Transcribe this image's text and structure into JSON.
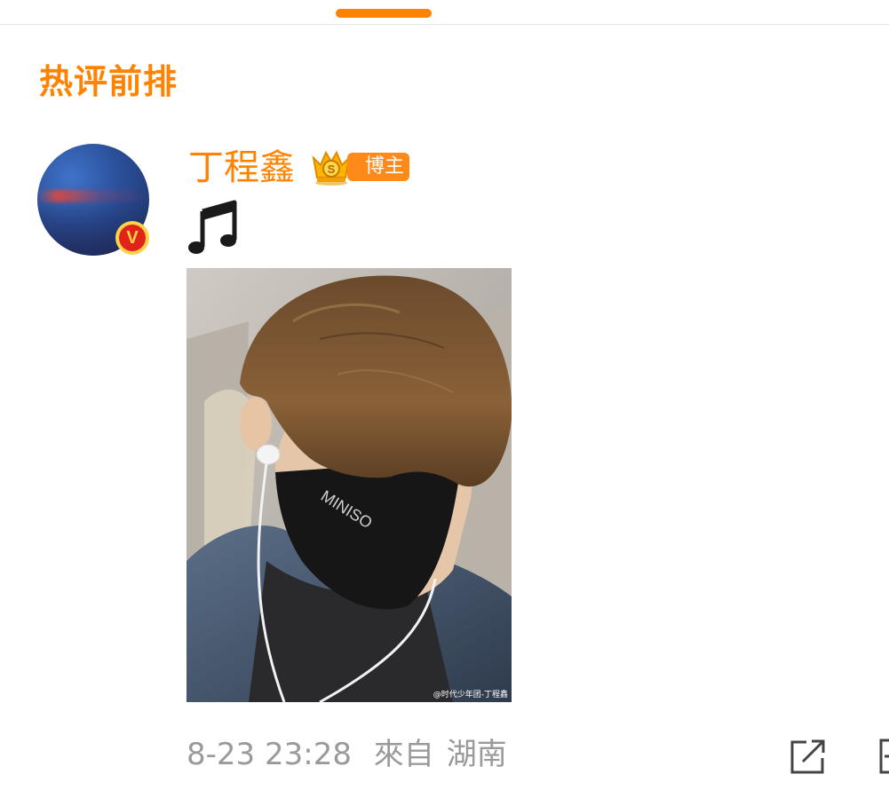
{
  "colors": {
    "accent": "#ff8200",
    "meta_text": "#9a9a9a",
    "verified_bg": "#e2231a",
    "verified_ring": "#ffd24a"
  },
  "section": {
    "title": "热评前排"
  },
  "post": {
    "author": {
      "name": "丁程鑫",
      "badge_label": "博主",
      "verified_mark": "V",
      "avatar_icon": "avatar-photo"
    },
    "content_icon": "music-note-icon",
    "image": {
      "watermark": "@时代少年团-丁程鑫",
      "mask_text": "MINISO"
    },
    "timestamp": "8-23 23:28",
    "source_prefix": "來自",
    "location": "湖南"
  },
  "actions": {
    "share_icon": "share-icon",
    "more_icon": "more-icon"
  }
}
